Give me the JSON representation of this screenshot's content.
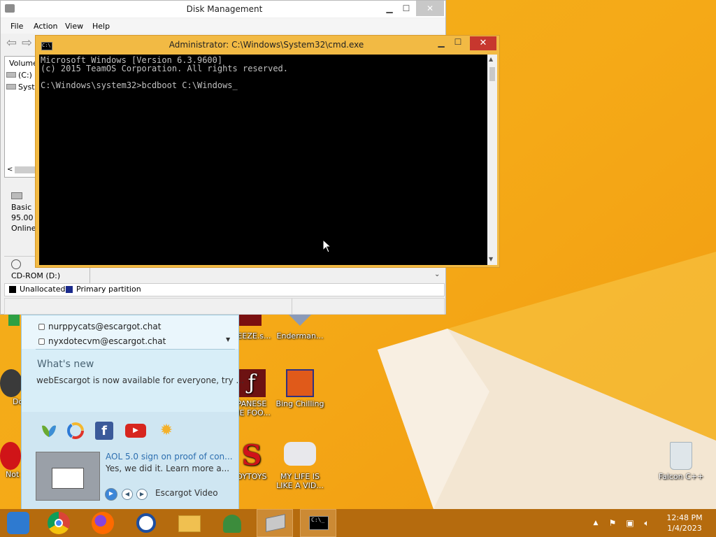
{
  "disk_management": {
    "title": "Disk Management",
    "menu": [
      "File",
      "Action",
      "View",
      "Help"
    ],
    "volume_header": "Volume",
    "volumes": [
      "(C:)",
      "Syste"
    ],
    "disk0": {
      "type": "Basic",
      "size": "95.00",
      "status": "Online"
    },
    "cdrom": "CD-ROM (D:)",
    "legend": {
      "unallocated": "Unallocated",
      "primary": "Primary partition"
    }
  },
  "cmd": {
    "title": "Administrator: C:\\Windows\\System32\\cmd.exe",
    "lines": [
      "Microsoft Windows [Version 6.3.9600]",
      "(c) 2015 TeamOS Corporation. All rights reserved.",
      "",
      "C:\\Windows\\system32>bcdboot C:\\Windows_"
    ]
  },
  "messenger": {
    "contacts": [
      "nurppycats@escargot.chat",
      "nyxdotecvm@escargot.chat"
    ],
    "whats_new_title": "What's new",
    "whats_new_body": "webEscargot is now available for everyone, try ...",
    "video_title": "AOL 5.0 sign on proof of con...",
    "video_desc": "Yes, we did it. Learn more a...",
    "video_label": "Escargot Video"
  },
  "desktop_icons": {
    "freeze": "EEEZE.s...",
    "enderman": "Enderman...",
    "japanese": "PANESE\nME FOO...",
    "bing_chilling": "Bing Chilling",
    "toys": "DYTOYS",
    "my_life": "MY LIFE IS\nLIKE A VID...",
    "falcon": "Falcon C++",
    "do": "Do",
    "not": "Not"
  },
  "clock": {
    "time": "12:48 PM",
    "date": "1/4/2023"
  }
}
